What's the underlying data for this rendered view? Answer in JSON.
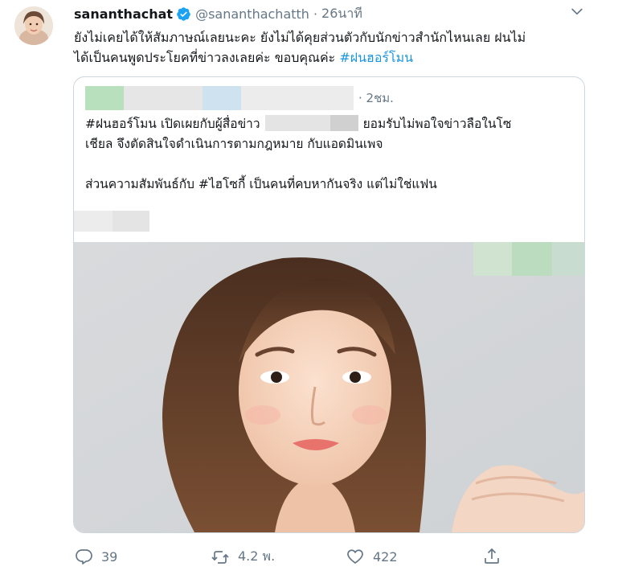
{
  "author": {
    "display_name": "sananthachat",
    "handle": "@sananthachatth",
    "time": "26นาที",
    "separator": "·"
  },
  "tweet": {
    "line1": "ยังไม่เคยได้ให้สัมภาษณ์เลยนะคะ ยังไม่ได้คุยส่วนตัวกับนักข่าวสำนักไหนเลย ฝนไม่",
    "line2_text": "ได้เป็นคนพูดประโยคที่ข่าวลงเลยค่ะ  ขอบคุณค่ะ ",
    "hashtag": "#ฝนฮอร์โมน"
  },
  "quoted": {
    "time": "· 2ชม.",
    "line1_before": "#ฝนฮอร์โมน เปิดเผยกับผู้สื่อข่าว",
    "line1_after": "ยอมรับไม่พอใจข่าวลือในโซ",
    "line2": "เชียล จึงตัดสินใจดำเนินการตามกฎหมาย กับแอดมินเพจ",
    "line3": "ส่วนความสัมพันธ์กับ #ไฮโซกี้ เป็นคนที่คบหากันจริง แต่ไม่ใช่แฟน"
  },
  "actions": {
    "reply_count": "39",
    "retweet_count": "4.2 พ.",
    "like_count": "422"
  },
  "colors": {
    "accent": "#1b95e0",
    "secondary_text": "#657786",
    "border": "#ccd6dd",
    "redact_green": "#b8e0bd",
    "redact_blue": "#cfe2f0",
    "redact_gray": "#e4e4e4"
  },
  "icons": [
    "verified-badge-icon",
    "chevron-down-icon",
    "reply-icon",
    "retweet-icon",
    "like-icon",
    "share-icon"
  ]
}
